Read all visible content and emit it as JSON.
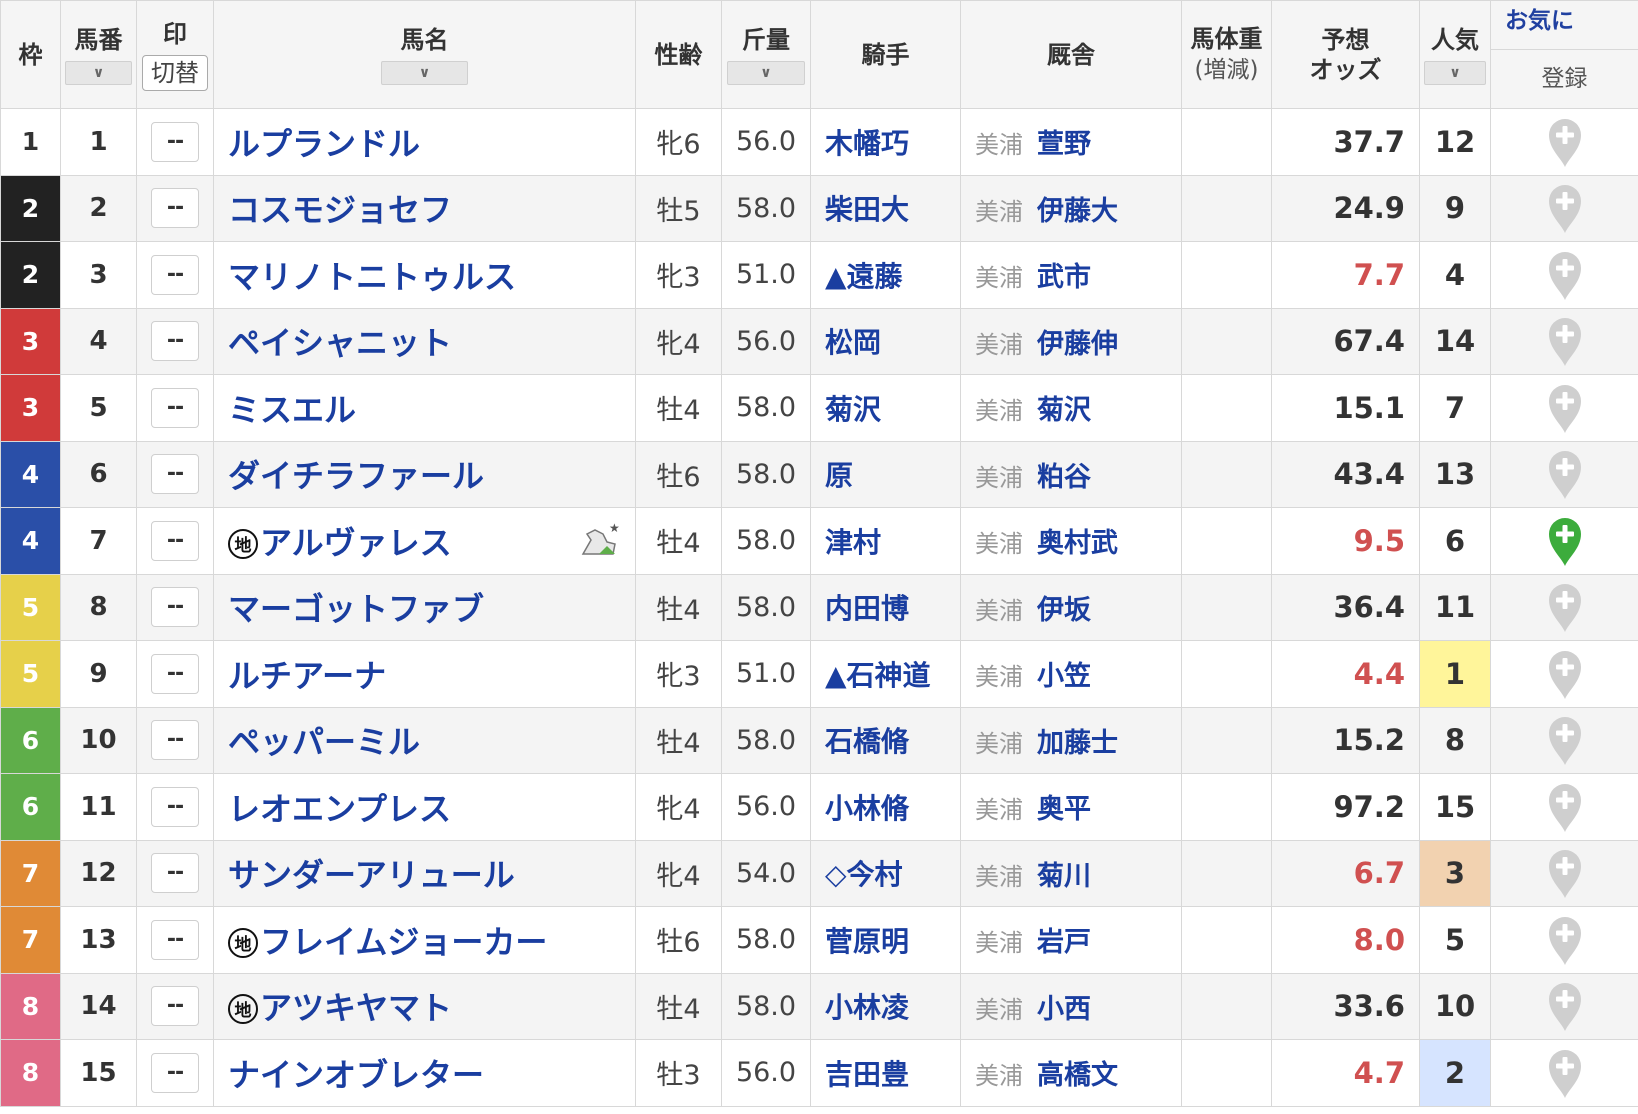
{
  "headers": {
    "waku": "枠",
    "umaban": "馬番",
    "mark": "印",
    "mark_toggle": "切替",
    "name": "馬名",
    "sexage": "性齢",
    "kinryo": "斤量",
    "jockey": "騎手",
    "stable": "厩舎",
    "weight": "馬体重",
    "weight_sub": "(増減)",
    "odds_line1": "予想",
    "odds_line2": "オッズ",
    "pop": "人気",
    "fav_line1": "お気に",
    "fav_line2": "登録",
    "sort_icon": "chevron-down-icon"
  },
  "colors": {
    "waku": {
      "1": "#ffffff",
      "2": "#222222",
      "3": "#d03a3a",
      "4": "#2a4fa8",
      "5": "#e6d04a",
      "6": "#5fae4a",
      "7": "#e08a36",
      "8": "#e06a86"
    },
    "pop_highlight": {
      "1": "#fff59a",
      "2": "#d6e4ff",
      "3": "#f2d2b0"
    },
    "fav_active": "#3cac3c",
    "fav_inactive": "#cfcfcf",
    "odds_low": "#d05050"
  },
  "horses": [
    {
      "waku": "1",
      "umaban": "1",
      "mark": "--",
      "chi": false,
      "name": "ルプランドル",
      "sex_age": "牝6",
      "kinryo": "56.0",
      "jockey": "木幡巧",
      "region": "美浦",
      "trainer": "萱野",
      "weight": "",
      "odds": "37.7",
      "pop": "12",
      "low": false,
      "fav": false
    },
    {
      "waku": "2",
      "umaban": "2",
      "mark": "--",
      "chi": false,
      "name": "コスモジョセフ",
      "sex_age": "牡5",
      "kinryo": "58.0",
      "jockey": "柴田大",
      "region": "美浦",
      "trainer": "伊藤大",
      "weight": "",
      "odds": "24.9",
      "pop": "9",
      "low": false,
      "fav": false
    },
    {
      "waku": "2",
      "umaban": "3",
      "mark": "--",
      "chi": false,
      "name": "マリノトニトゥルス",
      "sex_age": "牝3",
      "kinryo": "51.0",
      "jockey": "▲遠藤",
      "region": "美浦",
      "trainer": "武市",
      "weight": "",
      "odds": "7.7",
      "pop": "4",
      "low": true,
      "fav": false
    },
    {
      "waku": "3",
      "umaban": "4",
      "mark": "--",
      "chi": false,
      "name": "ペイシャニット",
      "sex_age": "牝4",
      "kinryo": "56.0",
      "jockey": "松岡",
      "region": "美浦",
      "trainer": "伊藤伸",
      "weight": "",
      "odds": "67.4",
      "pop": "14",
      "low": false,
      "fav": false
    },
    {
      "waku": "3",
      "umaban": "5",
      "mark": "--",
      "chi": false,
      "name": "ミスエル",
      "sex_age": "牡4",
      "kinryo": "58.0",
      "jockey": "菊沢",
      "region": "美浦",
      "trainer": "菊沢",
      "weight": "",
      "odds": "15.1",
      "pop": "7",
      "low": false,
      "fav": false
    },
    {
      "waku": "4",
      "umaban": "6",
      "mark": "--",
      "chi": false,
      "name": "ダイチラファール",
      "sex_age": "牡6",
      "kinryo": "58.0",
      "jockey": "原",
      "region": "美浦",
      "trainer": "粕谷",
      "weight": "",
      "odds": "43.4",
      "pop": "13",
      "low": false,
      "fav": false
    },
    {
      "waku": "4",
      "umaban": "7",
      "mark": "--",
      "chi": true,
      "chi_label": "地",
      "name": "アルヴァレス",
      "sex_age": "牡4",
      "kinryo": "58.0",
      "jockey": "津村",
      "region": "美浦",
      "trainer": "奥村武",
      "weight": "",
      "odds": "9.5",
      "pop": "6",
      "low": true,
      "fav": true,
      "horse_icon": "horse-star-icon"
    },
    {
      "waku": "5",
      "umaban": "8",
      "mark": "--",
      "chi": false,
      "name": "マーゴットファブ",
      "sex_age": "牡4",
      "kinryo": "58.0",
      "jockey": "内田博",
      "region": "美浦",
      "trainer": "伊坂",
      "weight": "",
      "odds": "36.4",
      "pop": "11",
      "low": false,
      "fav": false
    },
    {
      "waku": "5",
      "umaban": "9",
      "mark": "--",
      "chi": false,
      "name": "ルチアーナ",
      "sex_age": "牝3",
      "kinryo": "51.0",
      "jockey": "▲石神道",
      "region": "美浦",
      "trainer": "小笠",
      "weight": "",
      "odds": "4.4",
      "pop": "1",
      "low": true,
      "fav": false
    },
    {
      "waku": "6",
      "umaban": "10",
      "mark": "--",
      "chi": false,
      "name": "ペッパーミル",
      "sex_age": "牡4",
      "kinryo": "58.0",
      "jockey": "石橋脩",
      "region": "美浦",
      "trainer": "加藤士",
      "weight": "",
      "odds": "15.2",
      "pop": "8",
      "low": false,
      "fav": false
    },
    {
      "waku": "6",
      "umaban": "11",
      "mark": "--",
      "chi": false,
      "name": "レオエンプレス",
      "sex_age": "牝4",
      "kinryo": "56.0",
      "jockey": "小林脩",
      "region": "美浦",
      "trainer": "奥平",
      "weight": "",
      "odds": "97.2",
      "pop": "15",
      "low": false,
      "fav": false
    },
    {
      "waku": "7",
      "umaban": "12",
      "mark": "--",
      "chi": false,
      "name": "サンダーアリュール",
      "sex_age": "牝4",
      "kinryo": "54.0",
      "jockey": "◇今村",
      "region": "美浦",
      "trainer": "菊川",
      "weight": "",
      "odds": "6.7",
      "pop": "3",
      "low": true,
      "fav": false
    },
    {
      "waku": "7",
      "umaban": "13",
      "mark": "--",
      "chi": true,
      "chi_label": "地",
      "name": "フレイムジョーカー",
      "sex_age": "牡6",
      "kinryo": "58.0",
      "jockey": "菅原明",
      "region": "美浦",
      "trainer": "岩戸",
      "weight": "",
      "odds": "8.0",
      "pop": "5",
      "low": true,
      "fav": false
    },
    {
      "waku": "8",
      "umaban": "14",
      "mark": "--",
      "chi": true,
      "chi_label": "地",
      "name": "アツキヤマト",
      "sex_age": "牡4",
      "kinryo": "58.0",
      "jockey": "小林凌",
      "region": "美浦",
      "trainer": "小西",
      "weight": "",
      "odds": "33.6",
      "pop": "10",
      "low": false,
      "fav": false
    },
    {
      "waku": "8",
      "umaban": "15",
      "mark": "--",
      "chi": false,
      "name": "ナインオブレター",
      "sex_age": "牡3",
      "kinryo": "56.0",
      "jockey": "吉田豊",
      "region": "美浦",
      "trainer": "高橋文",
      "weight": "",
      "odds": "4.7",
      "pop": "2",
      "low": true,
      "fav": false
    }
  ]
}
